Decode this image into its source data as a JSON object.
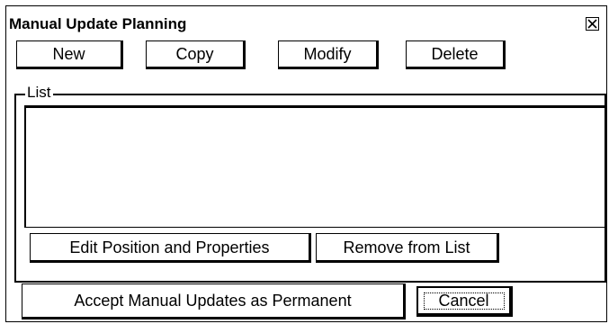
{
  "dialog": {
    "title": "Manual Update Planning",
    "close_icon": "close-x-icon"
  },
  "toolbar": {
    "new_label": "New",
    "copy_label": "Copy",
    "modify_label": "Modify",
    "delete_label": "Delete"
  },
  "list_group": {
    "label": "List",
    "items": [],
    "edit_label": "Edit Position and Properties",
    "remove_label": "Remove from List"
  },
  "footer": {
    "accept_label": "Accept Manual Updates as Permanent",
    "cancel_label": "Cancel"
  }
}
